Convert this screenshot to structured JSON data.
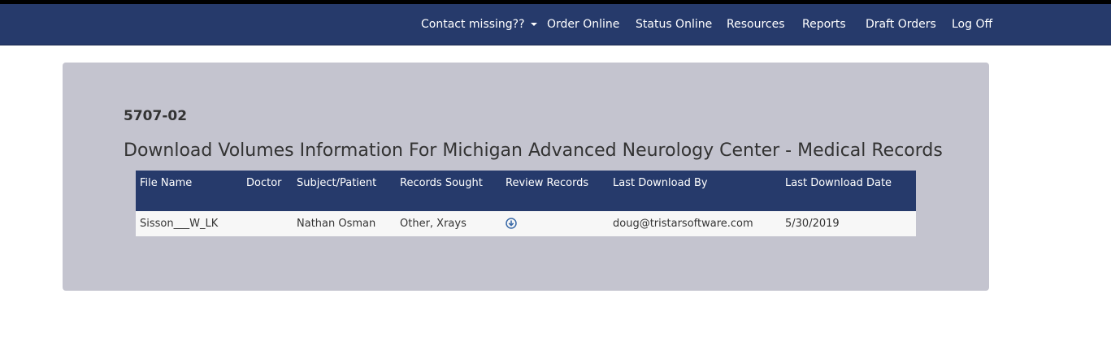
{
  "nav": {
    "items": [
      {
        "label": "Contact missing??",
        "dropdown": true
      },
      {
        "label": "Order Online"
      },
      {
        "label": "Status Online"
      },
      {
        "label": "Resources"
      },
      {
        "label": "Reports"
      },
      {
        "label": "Draft Orders"
      },
      {
        "label": "Log Off"
      }
    ]
  },
  "main": {
    "case_number": "5707-02",
    "title": "Download Volumes Information For Michigan Advanced Neurology Center - Medical Records"
  },
  "table": {
    "columns": [
      "File Name",
      "Doctor",
      "Subject/Patient",
      "Records Sought",
      "Review Records",
      "Last Download By",
      "Last Download Date"
    ],
    "rows": [
      {
        "file_name": "Sisson___W_LK",
        "doctor": "",
        "subject_patient": "Nathan Osman",
        "records_sought": "Other, Xrays",
        "review_icon": "download-circle-icon",
        "last_download_by": "doug@tristarsoftware.com",
        "last_download_date": "5/30/2019"
      }
    ]
  },
  "colors": {
    "navbar": "#263a6b",
    "panel": "#c4c4cf",
    "table_header": "#263a6b",
    "icon_accent": "#3a6aa8"
  }
}
